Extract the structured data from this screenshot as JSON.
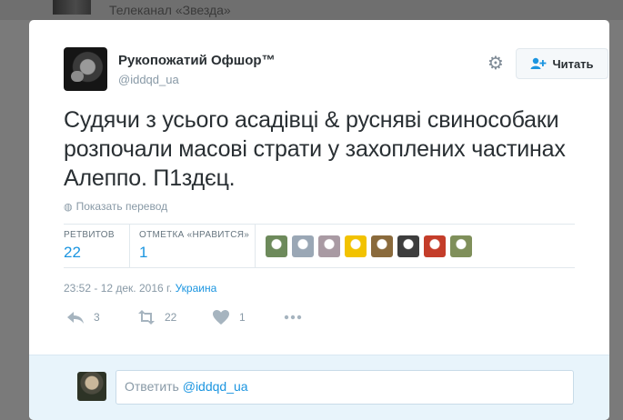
{
  "background": {
    "channel_text": "Телеканал «Звезда»"
  },
  "tweet": {
    "author": {
      "fullname": "Рукопожатий Офшор™",
      "username": "@iddqd_ua"
    },
    "follow_label": "Читать",
    "text": "Судячи з усього асадівці & русняві свинособаки розпочали масові страти у захоплених частинах Алеппо. П1здєц.",
    "translate_label": "Показать перевод",
    "stats": {
      "retweets_label": "РЕТВИТОВ",
      "retweets_value": "22",
      "likes_label": "ОТМЕТКА «НРАВИТСЯ»",
      "likes_value": "1"
    },
    "likers": [
      {
        "color": "#6d8a5b"
      },
      {
        "color": "#9aa7b5"
      },
      {
        "color": "#a99aa3"
      },
      {
        "color": "#f2c200"
      },
      {
        "color": "#8a6a3c"
      },
      {
        "color": "#3d3d3d"
      },
      {
        "color": "#c43d2a"
      },
      {
        "color": "#7f8f5a"
      }
    ],
    "timestamp": "23:52 - 12 дек. 2016 г.",
    "location": "Украина",
    "actions": {
      "reply_count": "3",
      "retweet_count": "22",
      "like_count": "1"
    },
    "reply": {
      "prefix": "Ответить",
      "mention": "@iddqd_ua"
    }
  },
  "colors": {
    "accent": "#1b95e0",
    "muted": "#8899a6",
    "reply_bg": "#e8f4fb"
  }
}
